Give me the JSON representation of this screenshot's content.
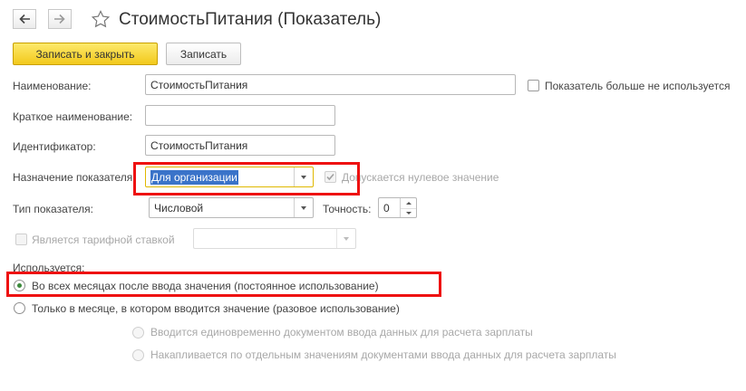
{
  "window": {
    "title": "СтоимостьПитания (Показатель)",
    "back_icon": "arrow-left-icon",
    "forward_icon": "arrow-right-icon",
    "favorite_icon": "star-outline-icon"
  },
  "toolbar": {
    "save_close_label": "Записать и закрыть",
    "save_label": "Записать"
  },
  "form": {
    "name_label": "Наименование:",
    "name_value": "СтоимостьПитания",
    "not_used_label": "Показатель больше не используется",
    "short_name_label": "Краткое наименование:",
    "short_name_value": "",
    "identifier_label": "Идентификатор:",
    "identifier_value": "СтоимостьПитания",
    "purpose_label": "Назначение показателя:",
    "purpose_value": "Для организации",
    "zero_allowed_label": "Допускается нулевое значение",
    "type_label": "Тип показателя:",
    "type_value": "Числовой",
    "precision_label": "Точность:",
    "precision_value": "0",
    "tariff_label": "Является тарифной ставкой",
    "tariff_value": "",
    "usage_group_label": "Используется:",
    "usage_options": [
      "Во всех месяцах после ввода значения (постоянное использование)",
      "Только в месяце, в котором вводится значение (разовое использование)"
    ],
    "usage_selected": 0,
    "once_sub_options": [
      "Вводится единовременно документом ввода данных для расчета зарплаты",
      "Накапливается по отдельным значениям документами ввода данных для расчета зарплаты"
    ],
    "zero_allowed_checked": true,
    "not_used_checked": false,
    "tariff_checked": false
  },
  "colors": {
    "primary_button": "#f5cf26",
    "highlight_border": "#ee1111",
    "selection": "#3a73c9",
    "radio_dot": "#3c8a3c"
  }
}
